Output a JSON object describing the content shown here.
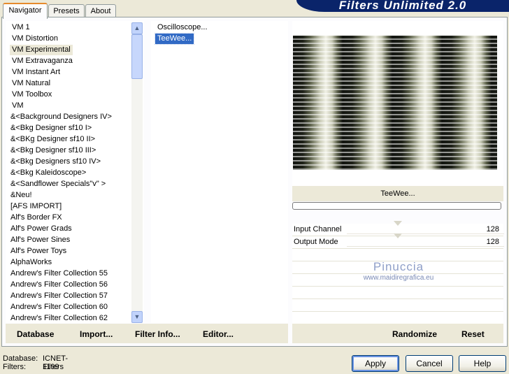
{
  "tabs": [
    "Navigator",
    "Presets",
    "About"
  ],
  "banner_title": "Filters Unlimited 2.0",
  "categories": [
    "VM 1",
    "VM Distortion",
    "VM Experimental",
    "VM Extravaganza",
    "VM Instant Art",
    "VM Natural",
    "VM Toolbox",
    "VM",
    "&<Background Designers IV>",
    "&<Bkg Designer sf10 I>",
    "&<BKg Designer sf10 II>",
    "&<Bkg Designer sf10 III>",
    "&<Bkg Designers sf10 IV>",
    "&<Bkg Kaleidoscope>",
    "&<Sandflower Specials\"v\" >",
    "&Neu!",
    "[AFS IMPORT]",
    "Alf's Border FX",
    "Alf's Power Grads",
    "Alf's Power Sines",
    "Alf's Power Toys",
    "AlphaWorks",
    "Andrew's Filter Collection 55",
    "Andrew's Filter Collection 56",
    "Andrew's Filter Collection 57",
    "Andrew's Filter Collection 60",
    "Andrew's Filter Collection 62"
  ],
  "selected_category": "VM Experimental",
  "filters": [
    "Oscilloscope...",
    "TeeWee..."
  ],
  "selected_filter": "TeeWee...",
  "preview_title": "TeeWee...",
  "params": [
    {
      "label": "Input Channel",
      "value": "128"
    },
    {
      "label": "Output Mode",
      "value": "128"
    }
  ],
  "watermark": {
    "line1": "Pinuccia",
    "line2": "www.maidiregrafica.eu"
  },
  "left_buttons": {
    "database": "Database",
    "import": "Import...",
    "filter_info": "Filter Info...",
    "editor": "Editor..."
  },
  "right_buttons": {
    "randomize": "Randomize",
    "reset": "Reset"
  },
  "status": {
    "database_label": "Database:",
    "database_value": "ICNET-Filters",
    "filters_label": "Filters:",
    "filters_value": "1199"
  },
  "dialog_buttons": {
    "apply": "Apply",
    "cancel": "Cancel",
    "help": "Help"
  },
  "icons": {
    "scroll_up": "scroll-up-arrow-icon",
    "scroll_down": "scroll-down-arrow-icon"
  },
  "colors": {
    "selection": "#316ac5",
    "banner": "#0a246a",
    "active_tab_accent": "#e68b2c"
  }
}
